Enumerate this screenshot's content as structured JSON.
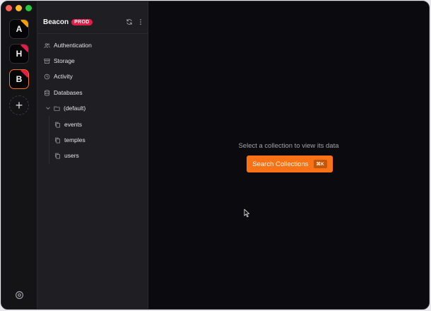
{
  "rail": {
    "projects": [
      {
        "letter": "A",
        "corner_color": "#f59e0b",
        "active": false
      },
      {
        "letter": "H",
        "corner_color": "#e11d48",
        "active": false
      },
      {
        "letter": "B",
        "corner_color": "#e11d48",
        "active": true
      }
    ],
    "add_label": "+",
    "accent_color": "#f97316"
  },
  "sidebar": {
    "title": "Beacon",
    "badge": "PROD",
    "badge_color": "#e11d48",
    "nav": [
      {
        "label": "Authentication",
        "icon": "users-icon"
      },
      {
        "label": "Storage",
        "icon": "archive-icon"
      },
      {
        "label": "Activity",
        "icon": "clock-icon"
      },
      {
        "label": "Databases",
        "icon": "database-icon"
      }
    ],
    "database": {
      "label": "(default)",
      "icon": "folder-icon",
      "expanded": true
    },
    "collections": [
      {
        "label": "events"
      },
      {
        "label": "temples"
      },
      {
        "label": "users"
      }
    ]
  },
  "main": {
    "empty_message": "Select a collection to view its data",
    "search_button": "Search Collections",
    "shortcut": "⌘K"
  }
}
